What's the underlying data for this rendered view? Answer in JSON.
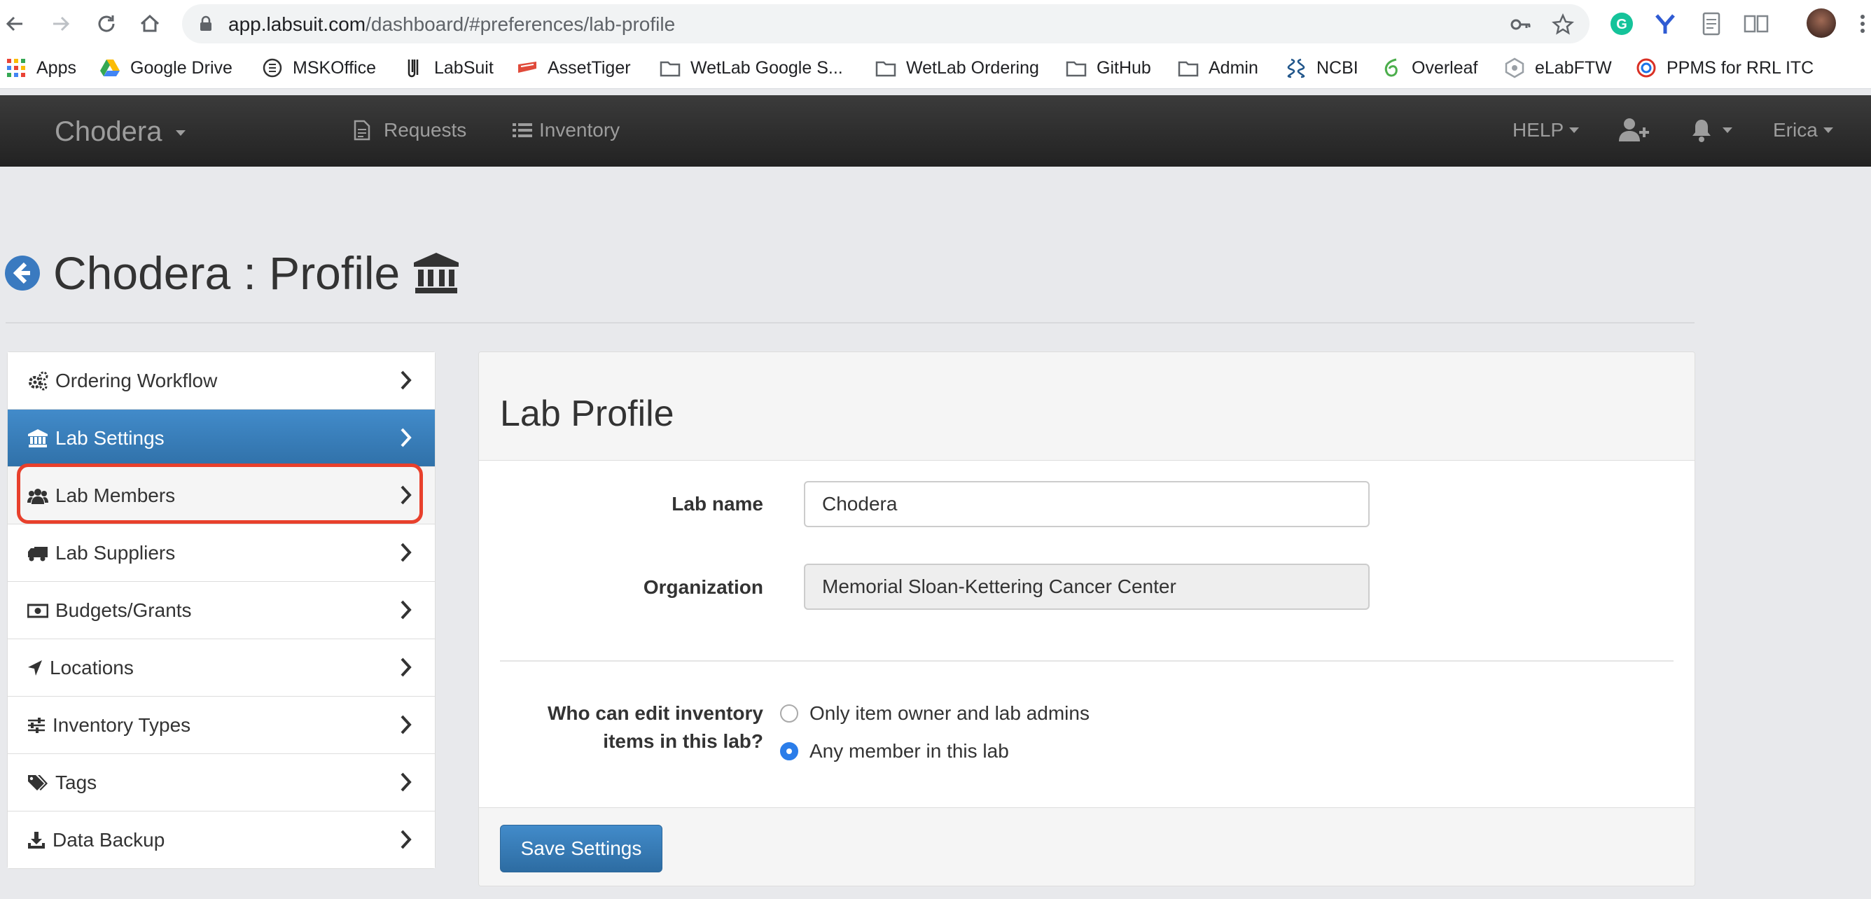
{
  "browser": {
    "url_host": "app.labsuit.com",
    "url_path": "/dashboard/#preferences/lab-profile",
    "bookmarks": [
      {
        "label": "Apps",
        "icon": "apps-grid-icon"
      },
      {
        "label": "Google Drive",
        "icon": "google-drive-icon"
      },
      {
        "label": "MSKOffice",
        "icon": "mskoffice-icon"
      },
      {
        "label": "LabSuit",
        "icon": "labsuit-icon"
      },
      {
        "label": "AssetTiger",
        "icon": "assettiger-icon"
      },
      {
        "label": "WetLab Google S...",
        "icon": "folder-icon"
      },
      {
        "label": "WetLab Ordering",
        "icon": "folder-icon"
      },
      {
        "label": "GitHub",
        "icon": "folder-icon"
      },
      {
        "label": "Admin",
        "icon": "folder-icon"
      },
      {
        "label": "NCBI",
        "icon": "ncbi-icon"
      },
      {
        "label": "Overleaf",
        "icon": "overleaf-icon"
      },
      {
        "label": "eLabFTW",
        "icon": "elabftw-icon"
      },
      {
        "label": "PPMS for RRL ITC",
        "icon": "ppms-icon"
      }
    ]
  },
  "navbar": {
    "brand": "Chodera",
    "requests": "Requests",
    "inventory": "Inventory",
    "help": "HELP",
    "user": "Erica"
  },
  "page": {
    "title": "Chodera : Profile"
  },
  "sidebar": {
    "items": [
      {
        "label": "Ordering Workflow",
        "icon": "gears-icon"
      },
      {
        "label": "Lab Settings",
        "icon": "bank-icon"
      },
      {
        "label": "Lab Members",
        "icon": "users-icon"
      },
      {
        "label": "Lab Suppliers",
        "icon": "truck-icon"
      },
      {
        "label": "Budgets/Grants",
        "icon": "money-icon"
      },
      {
        "label": "Locations",
        "icon": "location-arrow-icon"
      },
      {
        "label": "Inventory Types",
        "icon": "sliders-icon"
      },
      {
        "label": "Tags",
        "icon": "tags-icon"
      },
      {
        "label": "Data Backup",
        "icon": "download-icon"
      }
    ],
    "active_index": 1,
    "highlighted_index": 2
  },
  "profile": {
    "heading": "Lab Profile",
    "lab_name_label": "Lab name",
    "lab_name_value": "Chodera",
    "organization_label": "Organization",
    "organization_value": "Memorial Sloan-Kettering Cancer Center",
    "edit_question_line1": "Who can edit inventory",
    "edit_question_line2": "items in this lab?",
    "options": [
      {
        "label": "Only item owner and lab admins",
        "checked": false
      },
      {
        "label": "Any member in this lab",
        "checked": true
      }
    ],
    "save_label": "Save Settings"
  },
  "colors": {
    "navbar": "#222222",
    "active_item": "#428bca",
    "highlight_ring": "#e8402c",
    "radio_checked": "#2b7de9"
  }
}
